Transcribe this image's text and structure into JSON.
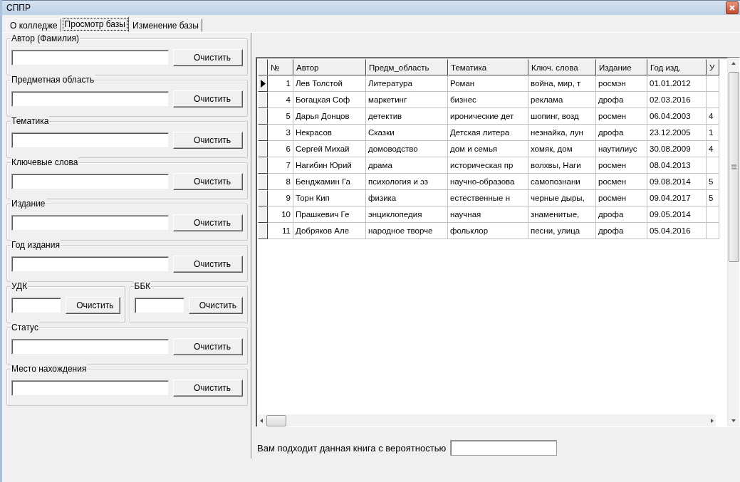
{
  "window": {
    "title": "СППР"
  },
  "tabs": [
    {
      "label": "О колледже",
      "selected": false
    },
    {
      "label": "Просмотр базы",
      "selected": true
    },
    {
      "label": "Изменение базы",
      "selected": false
    }
  ],
  "filters": [
    {
      "kind": "full",
      "label": "Автор (Фамилия)",
      "button": "Очистить"
    },
    {
      "kind": "full",
      "label": "Предметная область",
      "button": "Очистить"
    },
    {
      "kind": "full",
      "label": "Тематика",
      "button": "Очистить"
    },
    {
      "kind": "full",
      "label": "Ключевые слова",
      "button": "Очистить"
    },
    {
      "kind": "full",
      "label": "Издание",
      "button": "Очистить"
    },
    {
      "kind": "full",
      "label": "Год издания",
      "button": "Очистить"
    },
    {
      "kind": "half",
      "label": "УДК",
      "button": "Очистить"
    },
    {
      "kind": "half",
      "label": "ББК",
      "button": "Очистить"
    },
    {
      "kind": "full",
      "label": "Статус",
      "button": "Очистить"
    },
    {
      "kind": "full",
      "label": "Место нахождения",
      "button": "Очистить"
    }
  ],
  "table": {
    "columns": [
      "№",
      "Автор",
      "Предм_область",
      "Тематика",
      "Ключ. слова",
      "Издание",
      "Год изд.",
      "У"
    ],
    "rows": [
      {
        "selected": true,
        "cells": [
          "1",
          "Лев Толстой",
          "Литература",
          "Роман",
          "война, мир, т",
          "росмэн",
          "01.01.2012"
        ]
      },
      {
        "selected": false,
        "cells": [
          "4",
          "Богацкая Соф",
          "маркетинг",
          "бизнес",
          "реклама",
          "дрофа",
          "02.03.2016"
        ]
      },
      {
        "selected": false,
        "cells": [
          "5",
          "Дарья Донцов",
          "детектив",
          "иронические дет",
          "шопинг, возд",
          "росмен",
          "06.04.2003",
          "4"
        ]
      },
      {
        "selected": false,
        "cells": [
          "3",
          "Некрасов",
          "Сказки",
          "Детская литера",
          "незнайка, лун",
          "дрофа",
          "23.12.2005",
          "1"
        ]
      },
      {
        "selected": false,
        "cells": [
          "6",
          "Сергей Михай",
          "домоводство",
          "дом и семья",
          "хомяк, дом",
          "наутилиус",
          "30.08.2009",
          "4"
        ]
      },
      {
        "selected": false,
        "cells": [
          "7",
          "Нагибин Юрий",
          "драма",
          "историческая пр",
          "волхвы, Наги",
          "росмен",
          "08.04.2013"
        ]
      },
      {
        "selected": false,
        "cells": [
          "8",
          "Бенджамин Га",
          "психология и эз",
          "научно-образова",
          "самопознани",
          "росмен",
          "09.08.2014",
          "5"
        ]
      },
      {
        "selected": false,
        "cells": [
          "9",
          "Торн Кип",
          "физика",
          "естественные н",
          "черные дыры,",
          "росмен",
          "09.04.2017",
          "5"
        ]
      },
      {
        "selected": false,
        "cells": [
          "10",
          "Прашкевич Ге",
          "энциклопедия",
          "научная",
          "знаменитые,",
          "дрофа",
          "09.05.2014"
        ]
      },
      {
        "selected": false,
        "cells": [
          "11",
          "Добряков Але",
          "народное творче",
          "фольклор",
          "песни, улица",
          "дрофа",
          "05.04.2016"
        ]
      }
    ]
  },
  "probability": {
    "label": "Вам подходит данная книга с вероятностью"
  }
}
